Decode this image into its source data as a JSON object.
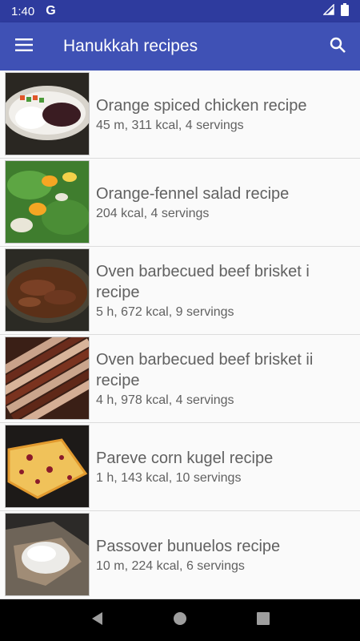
{
  "status": {
    "time": "1:40",
    "google_glyph": "G"
  },
  "app_bar": {
    "title": "Hanukkah recipes",
    "menu_icon": "hamburger-menu-icon",
    "search_icon": "search-icon"
  },
  "recipes": [
    {
      "title": "Orange spiced chicken recipe",
      "subtitle": "45 m, 311 kcal, 4 servings"
    },
    {
      "title": "Orange-fennel salad recipe",
      "subtitle": "204 kcal, 4 servings"
    },
    {
      "title": "Oven barbecued beef brisket i recipe",
      "subtitle": "5 h, 672 kcal, 9 servings"
    },
    {
      "title": "Oven barbecued beef brisket ii recipe",
      "subtitle": "4 h, 978 kcal, 4 servings"
    },
    {
      "title": "Pareve corn kugel recipe",
      "subtitle": "1 h, 143 kcal, 10 servings"
    },
    {
      "title": "Passover bunuelos recipe",
      "subtitle": "10 m, 224 kcal, 6 servings"
    }
  ],
  "colors": {
    "status_bar": "#2e3b9e",
    "app_bar": "#3f51b5",
    "text": "#616161"
  }
}
